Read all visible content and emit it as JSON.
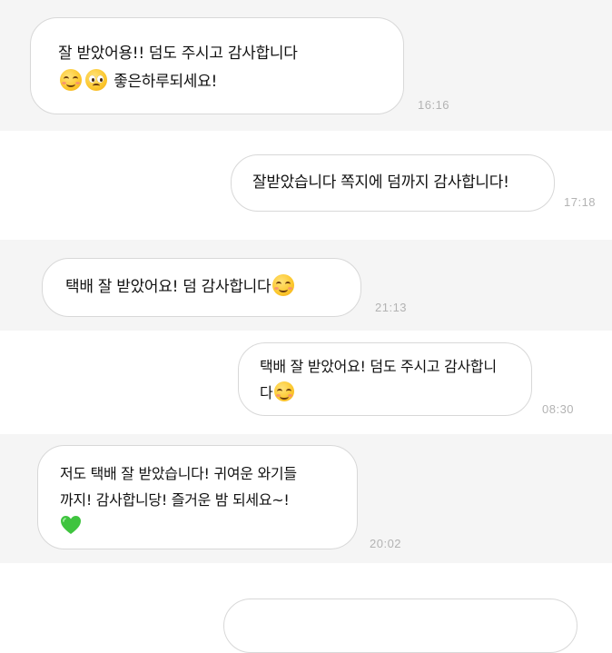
{
  "colors": {
    "background": "#ffffff",
    "alt_band": "#f5f5f5",
    "bubble_border": "#d8d8d8",
    "timestamp": "#b3b3b3",
    "heart": "#3fc43f"
  },
  "messages": [
    {
      "side": "left",
      "lines": [
        "잘 받았어용!! 덤도 주시고 감사합니다",
        "좋은하루되세요!"
      ],
      "emojis": [
        "relieved-smile-emoji",
        "pleading-face-emoji"
      ],
      "time": "16:16"
    },
    {
      "side": "right",
      "lines": [
        "잘받았습니다 쪽지에 덤까지 감사합니다!"
      ],
      "time": "17:18"
    },
    {
      "side": "left",
      "lines": [
        "택배 잘 받았어요! 덤 감사합니다"
      ],
      "emojis": [
        "smiling-face-emoji"
      ],
      "time": "21:13"
    },
    {
      "side": "right",
      "lines": [
        "택배 잘 받았어요! 덤도 주시고 감사합니",
        "다"
      ],
      "emojis": [
        "smiling-face-emoji"
      ],
      "time": "08:30"
    },
    {
      "side": "left",
      "lines": [
        "저도 택배 잘 받았습니다! 귀여운 와기들",
        "까지! 감사합니당! 즐거운 밤 되세요~!"
      ],
      "emojis": [
        "green-heart-emoji"
      ],
      "time": "20:02"
    }
  ]
}
